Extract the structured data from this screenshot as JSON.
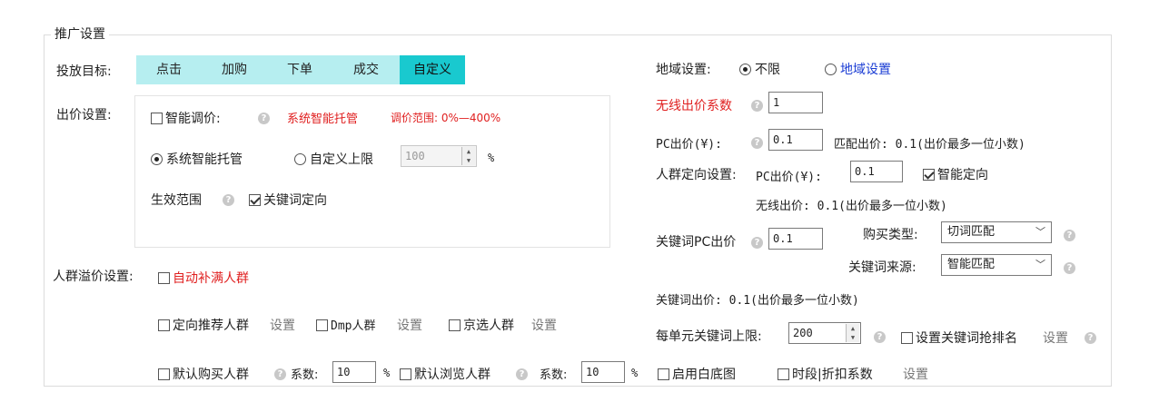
{
  "section": {
    "title": "推广设置"
  },
  "target": {
    "label": "投放目标:",
    "tabs": [
      "点击",
      "加购",
      "下单",
      "成交",
      "自定义"
    ],
    "active": 4
  },
  "bid": {
    "label": "出价设置:",
    "smart_adjust": "智能调价:",
    "system_hosting_red": "系统智能托管",
    "range_red": "调价范围: 0%—400%",
    "radio_system": "系统智能托管",
    "radio_custom": "自定义上限",
    "custom_value": "100",
    "percent": "%",
    "scope_label": "生效范围",
    "keyword_targeting": "关键词定向"
  },
  "crowd": {
    "label": "人群溢价设置:",
    "auto_fill": "自动补满人群",
    "targeted_recommend": "定向推荐人群",
    "set": "设置",
    "dmp": "Dmp人群",
    "jd_select": "京选人群",
    "default_buy": "默认购买人群",
    "coef_label": "系数:",
    "coef_buy": "10",
    "percent": "%",
    "default_browse": "默认浏览人群",
    "coef_browse": "10"
  },
  "region": {
    "label": "地域设置:",
    "unlimited": "不限",
    "region_settings": "地域设置"
  },
  "wireless": {
    "label": "无线出价系数",
    "value": "1"
  },
  "pc_bid": {
    "label": "PC出价(¥):",
    "value": "0.1",
    "match_bid": "匹配出价: 0.1(出价最多一位小数)"
  },
  "crowd_target": {
    "label": "人群定向设置:",
    "pc_label": "PC出价(¥):",
    "value": "0.1",
    "smart_target": "智能定向",
    "wireless_bid": "无线出价: 0.1(出价最多一位小数)"
  },
  "keyword": {
    "pc_label": "关键词PC出价",
    "pc_value": "0.1",
    "buy_type_label": "购买类型:",
    "buy_type_value": "切词匹配",
    "source_label": "关键词来源:",
    "source_value": "智能匹配",
    "bid_text": "关键词出价: 0.1(出价最多一位小数)",
    "limit_label": "每单元关键词上限:",
    "limit_value": "200",
    "rank_label": "设置关键词抢排名",
    "set": "设置"
  },
  "misc": {
    "white_bg": "启用白底图",
    "time_discount": "时段|折扣系数",
    "set": "设置"
  }
}
